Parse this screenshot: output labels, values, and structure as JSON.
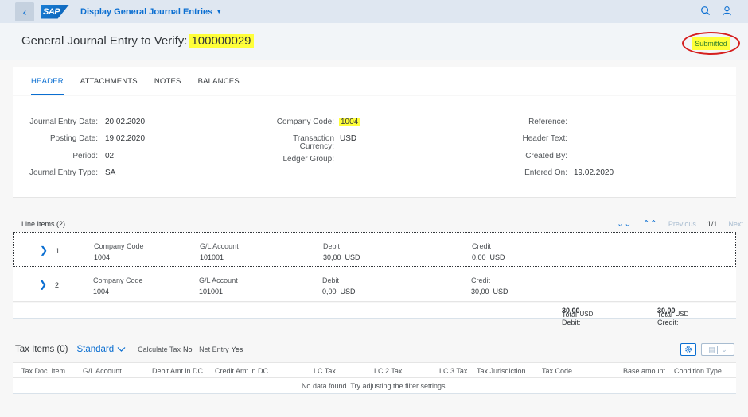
{
  "shell": {
    "logo": "SAP",
    "app_title": "Display General Journal Entries"
  },
  "object": {
    "title_prefix": "General Journal Entry to Verify:",
    "id": "100000029",
    "status": "Submitted"
  },
  "tabs": [
    "HEADER",
    "ATTACHMENTS",
    "NOTES",
    "BALANCES"
  ],
  "header_fields": {
    "col1": [
      {
        "label": "Journal Entry Date:",
        "value": "20.02.2020"
      },
      {
        "label": "Posting Date:",
        "value": "19.02.2020"
      },
      {
        "label": "Period:",
        "value": "02"
      },
      {
        "label": "Journal Entry Type:",
        "value": "SA"
      }
    ],
    "col2": {
      "company_code_label": "Company Code:",
      "company_code_value": "1004",
      "currency_label_1": "Transaction",
      "currency_label_2": "Currency:",
      "currency_value": "USD",
      "ledger_label": "Ledger Group:"
    },
    "col3": [
      {
        "label": "Reference:",
        "value": ""
      },
      {
        "label": "Header Text:",
        "value": ""
      },
      {
        "label": "Created By:",
        "value": ""
      },
      {
        "label": "Entered On:",
        "value": "19.02.2020"
      }
    ]
  },
  "line_items": {
    "title": "Line Items (2)",
    "previous": "Previous",
    "page": "1/1",
    "next": "Next",
    "rows": [
      {
        "num": "1",
        "company_code_label": "Company Code",
        "company_code": "1004",
        "gl_label": "G/L Account",
        "gl": "101001",
        "debit_label": "Debit",
        "debit": "30,00",
        "debit_cur": "USD",
        "credit_label": "Credit",
        "credit": "0,00",
        "credit_cur": "USD"
      },
      {
        "num": "2",
        "company_code_label": "Company Code",
        "company_code": "1004",
        "gl_label": "G/L Account",
        "gl": "101001",
        "debit_label": "Debit",
        "debit": "0,00",
        "debit_cur": "USD",
        "credit_label": "Credit",
        "credit": "30,00",
        "credit_cur": "USD"
      }
    ],
    "total_debit_label": "Total Debit:",
    "total_debit": "30,00",
    "total_credit_label": "Total Credit:",
    "total_credit": "30,00",
    "total_cur": "USD"
  },
  "tax": {
    "title": "Tax Items (0)",
    "variant": "Standard",
    "calc_tax_label": "Calculate Tax",
    "calc_tax_value": "No",
    "net_entry_label": "Net Entry",
    "net_entry_value": "Yes",
    "columns": [
      "Tax Doc. Item",
      "G/L Account",
      "Debit Amt in DC",
      "Credit Amt in DC",
      "LC Tax",
      "LC 2 Tax",
      "LC 3 Tax",
      "Tax Jurisdiction",
      "Tax Code",
      "Base amount",
      "Condition Type"
    ],
    "empty": "No data found. Try adjusting the filter settings."
  }
}
